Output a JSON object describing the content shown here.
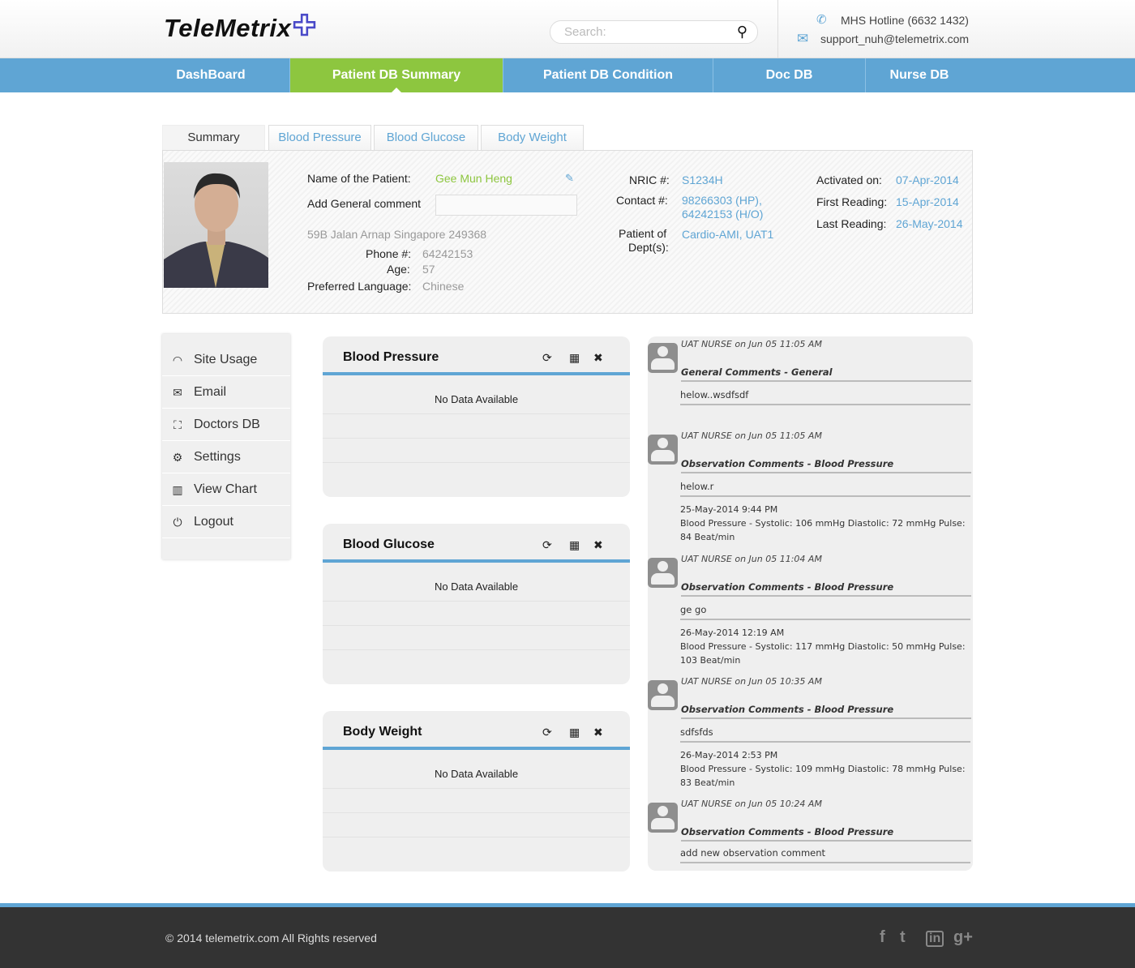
{
  "header": {
    "logo": "TeleMetrix",
    "logo_mark": "✚",
    "search_placeholder": "Search:",
    "hotline": "MHS Hotline (6632 1432)",
    "email": "support_nuh@telemetrix.com"
  },
  "nav": [
    {
      "label": "DashBoard"
    },
    {
      "label": "Patient DB Summary",
      "active": true
    },
    {
      "label": "Patient DB Condition"
    },
    {
      "label": "Doc DB"
    },
    {
      "label": "Nurse DB"
    }
  ],
  "tabs": [
    {
      "label": "Summary",
      "active": true
    },
    {
      "label": "Blood Pressure"
    },
    {
      "label": "Blood Glucose"
    },
    {
      "label": "Body Weight"
    }
  ],
  "patient": {
    "name_label": "Name of the Patient:",
    "name": "Gee Mun Heng",
    "comment_label": "Add General comment",
    "comment_value": "",
    "address": "59B Jalan Arnap Singapore 249368",
    "phone_label": "Phone #:",
    "phone": "64242153",
    "age_label": "Age:",
    "age": "57",
    "lang_label": "Preferred Language:",
    "lang": "Chinese",
    "nric_label": "NRIC #:",
    "nric": "S1234H",
    "contact_label": "Contact #:",
    "contact1": "98266303 (HP),",
    "contact2": "64242153 (H/O)",
    "dept_label1": "Patient of",
    "dept_label2": "Dept(s):",
    "dept": "Cardio-AMI, UAT1",
    "activated_label": "Activated on:",
    "activated": "07-Apr-2014",
    "first_label": "First Reading:",
    "first": "15-Apr-2014",
    "last_label": "Last Reading:",
    "last": "26-May-2014"
  },
  "sidebar": [
    {
      "label": "Site Usage",
      "icon": "◠"
    },
    {
      "label": "Email",
      "icon": "✉"
    },
    {
      "label": "Doctors DB",
      "icon": "⛶"
    },
    {
      "label": "Settings",
      "icon": "⚙"
    },
    {
      "label": "View Chart",
      "icon": "▥"
    },
    {
      "label": "Logout",
      "icon": "⏻"
    }
  ],
  "widgets": [
    {
      "title": "Blood Pressure",
      "empty": "No Data Available"
    },
    {
      "title": "Blood Glucose",
      "empty": "No Data Available"
    },
    {
      "title": "Body Weight",
      "empty": "No Data Available"
    }
  ],
  "widget_icons": {
    "refresh": "⟳",
    "calendar": "▦",
    "close": "✖"
  },
  "comments": [
    {
      "who": "UAT NURSE on Jun 05 11:05 AM",
      "title": "General Comments - General",
      "text": "helow..wsdfsdf",
      "date": "",
      "reading": ""
    },
    {
      "who": "UAT NURSE on Jun 05 11:05 AM",
      "title": "Observation Comments - Blood Pressure",
      "text": "helow.r",
      "date": "25-May-2014 9:44 PM",
      "reading": "Blood Pressure - Systolic: 106 mmHg Diastolic: 72 mmHg Pulse: 84 Beat/min"
    },
    {
      "who": "UAT NURSE on Jun 05 11:04 AM",
      "title": "Observation Comments - Blood Pressure",
      "text": "ge go",
      "date": "26-May-2014 12:19 AM",
      "reading": "Blood Pressure - Systolic: 117 mmHg Diastolic: 50 mmHg Pulse: 103 Beat/min"
    },
    {
      "who": "UAT NURSE on Jun 05 10:35 AM",
      "title": "Observation Comments - Blood Pressure",
      "text": "sdfsfds",
      "date": "26-May-2014 2:53 PM",
      "reading": "Blood Pressure - Systolic: 109 mmHg Diastolic: 78 mmHg Pulse: 83 Beat/min"
    },
    {
      "who": "UAT NURSE on Jun 05 10:24 AM",
      "title": "Observation Comments - Blood Pressure",
      "text": "add new observation comment",
      "date": "",
      "reading": ""
    }
  ],
  "footer": {
    "copyright": "© 2014 telemetrix.com All Rights reserved",
    "social": [
      "f",
      "t",
      "in",
      "g+"
    ]
  },
  "colors": {
    "nav": "#5fa5d4",
    "active": "#8dc63f",
    "footer": "#333333"
  }
}
